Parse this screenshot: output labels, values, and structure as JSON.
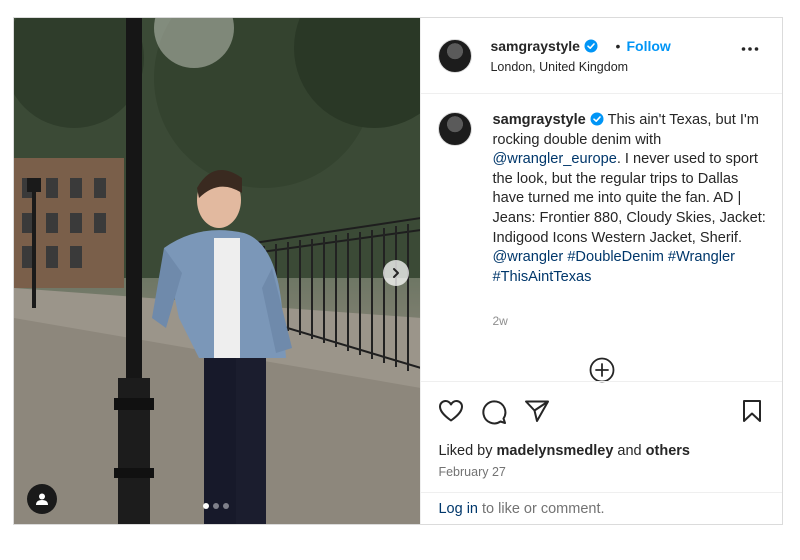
{
  "post": {
    "username": "samgraystyle",
    "follow_label": "Follow",
    "separator": "•",
    "location": "London, United Kingdom",
    "caption": {
      "username": "samgraystyle",
      "part1": "This ain't Texas, but I'm rocking double denim with",
      "mention1": "@wrangler_europe",
      "part2": ". I never used to sport the look, but the regular trips to Dallas have turned me into quite the fan. AD | Jeans: Frontier 880, Cloudy Skies, Jacket: Indigood Icons Western Jacket, Sherif.",
      "mention2": "@wrangler",
      "hashtag1": "#DoubleDenim",
      "hashtag2": "#Wrangler",
      "hashtag3": "#ThisAintTexas"
    },
    "age": "2w",
    "liked_prefix": "Liked by",
    "liked_user": "madelynsmedley",
    "liked_and": "and",
    "liked_others": "others",
    "date": "February 27",
    "login_link": "Log in",
    "login_suffix": "to like or comment."
  },
  "icons": {
    "verified": "verified-badge-icon",
    "more": "more-options-icon",
    "next": "chevron-right-icon",
    "user_tag": "user-tag-icon",
    "add": "add-circle-icon",
    "like": "heart-icon",
    "comment": "comment-icon",
    "share": "share-icon",
    "save": "bookmark-icon"
  },
  "carousel": {
    "total": 3,
    "active": 1
  },
  "colors": {
    "accent": "#0095f6",
    "link": "#00376b",
    "text": "#262626",
    "muted": "#737373",
    "verified": "#0095f6"
  }
}
